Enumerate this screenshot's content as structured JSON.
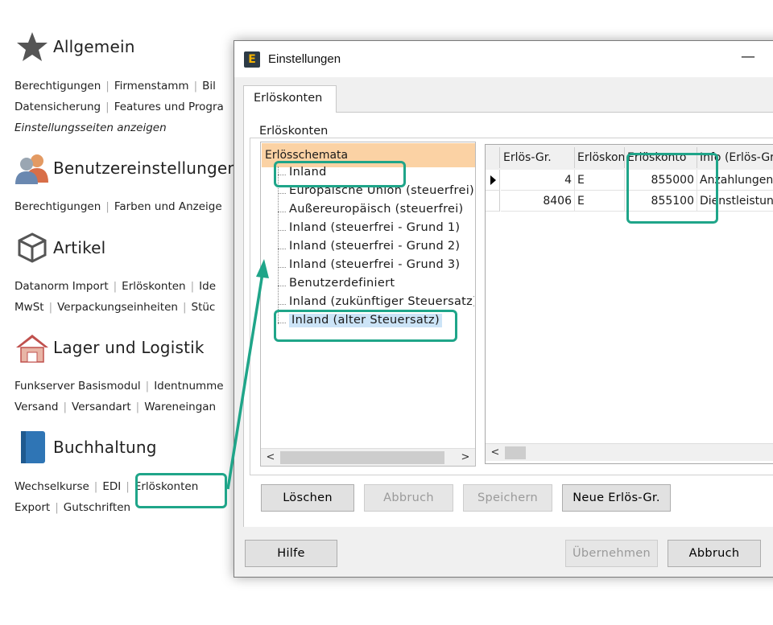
{
  "background": {
    "sections": [
      {
        "title": "Allgemein",
        "icon": "star-icon",
        "lines": [
          [
            "Berechtigungen",
            "Firmenstamm",
            "Bil"
          ],
          [
            "Datensicherung",
            "Features und Progra"
          ]
        ],
        "extra": "Einstellungsseiten anzeigen"
      },
      {
        "title": "Benutzereinstellungen",
        "icon": "users-icon",
        "lines": [
          [
            "Berechtigungen",
            "Farben und Anzeige"
          ]
        ]
      },
      {
        "title": "Artikel",
        "icon": "box-icon",
        "lines": [
          [
            "Datanorm Import",
            "Erlöskonten",
            "Ide"
          ],
          [
            "MwSt",
            "Verpackungseinheiten",
            "Stüc"
          ]
        ]
      },
      {
        "title": "Lager und Logistik",
        "icon": "warehouse-icon",
        "lines": [
          [
            "Funkserver Basismodul",
            "Identnumme"
          ],
          [
            "Versand",
            "Versandart",
            "Wareneingan"
          ]
        ]
      },
      {
        "title": "Buchhaltung",
        "icon": "book-icon",
        "lines": [
          [
            "Wechselkurse",
            "EDI",
            "Erlöskonten"
          ],
          [
            "Export",
            "Gutschriften"
          ]
        ]
      }
    ]
  },
  "dialog": {
    "title": "Einstellungen",
    "app_icon_letter": "E",
    "minimize": "—",
    "tab": "Erlöskonten",
    "group_label": "Erlöskonten",
    "tree": {
      "header": "Erlösschemata",
      "items": [
        "Inland",
        "Europäische Union (steuerfrei)",
        "Außereuropäisch (steuerfrei)",
        "Inland (steuerfrei - Grund 1)",
        "Inland (steuerfrei - Grund 2)",
        "Inland (steuerfrei - Grund 3)",
        "Benutzerdefiniert",
        "Inland (zukünftiger Steuersatz)",
        "Inland (alter Steuersatz)"
      ],
      "selected_index": 8
    },
    "grid": {
      "columns": [
        "Erlös-Gr.",
        "Erlöskonto-Typ",
        "Erlöskonto",
        "Info (Erlös-Gr.)"
      ],
      "rows": [
        [
          "4",
          "E",
          "855000",
          "Anzahlungen"
        ],
        [
          "8406",
          "E",
          "855100",
          "Dienstleistungen"
        ]
      ],
      "current_row": 0
    },
    "buttons": {
      "delete": "Löschen",
      "cancel_edit": "Abbruch",
      "save": "Speichern",
      "new_group": "Neue Erlös-Gr.",
      "help": "Hilfe",
      "apply": "Übernehmen",
      "cancel": "Abbruch"
    },
    "scroll_left": "<",
    "scroll_right": ">"
  },
  "colors": {
    "annotation": "#1fa589",
    "tree_header": "#fbd2a4",
    "selection": "#cce4f7"
  }
}
